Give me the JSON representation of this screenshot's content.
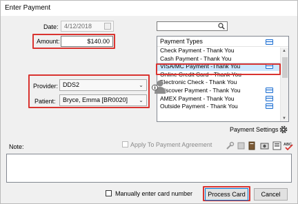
{
  "window": {
    "title": "Enter Payment"
  },
  "date": {
    "label": "Date:",
    "value": "4/12/2018"
  },
  "amount": {
    "label": "Amount:",
    "value": "$140.00"
  },
  "search": {
    "value": ""
  },
  "payment_types": {
    "header": "Payment Types",
    "items": [
      {
        "label": "Check Payment - Thank You",
        "card": false,
        "selected": false
      },
      {
        "label": "Cash Payment - Thank You",
        "card": false,
        "selected": false
      },
      {
        "label": "VISA/MC Payment -Thank You",
        "card": true,
        "selected": true
      },
      {
        "label": "Online Credit Card - Thank You",
        "card": false,
        "selected": false
      },
      {
        "label": "Electronic Check - Thank You",
        "card": false,
        "selected": false
      },
      {
        "label": "Discover Payment - Thank You",
        "card": true,
        "selected": false
      },
      {
        "label": "AMEX Payment - Thank You",
        "card": true,
        "selected": false
      },
      {
        "label": "Outside Payment - Thank You",
        "card": false,
        "selected": false
      }
    ]
  },
  "provider": {
    "label": "Provider:",
    "value": "DDS2"
  },
  "patient": {
    "label": "Patient:",
    "value": "Bryce, Emma [BR0020]"
  },
  "payment_settings": {
    "label": "Payment Settings"
  },
  "note": {
    "label": "Note:",
    "value": ""
  },
  "agreement": {
    "label": "Apply To Payment Agreement",
    "checked": false
  },
  "manual_card": {
    "label": "Manually enter card number",
    "checked": false
  },
  "buttons": {
    "process_card": "Process Card",
    "cancel": "Cancel"
  },
  "colors": {
    "highlight": "#d9332f",
    "selection": "#cce8ff",
    "card_icon": "#1e6fd0"
  }
}
